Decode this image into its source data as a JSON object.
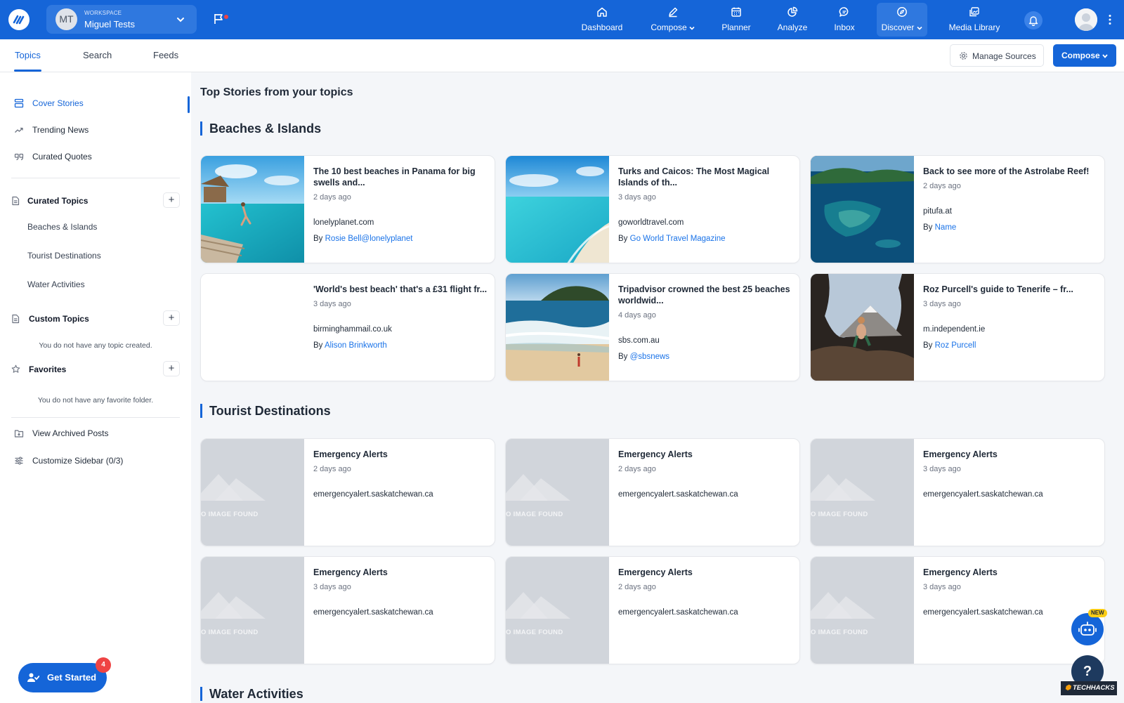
{
  "topnav": {
    "workspace_tag": "WORKSPACE",
    "workspace_initials": "MT",
    "workspace_name": "Miguel Tests",
    "items": [
      {
        "label": "Dashboard",
        "icon": "home-icon"
      },
      {
        "label": "Compose",
        "icon": "pencil-icon",
        "dropdown": true
      },
      {
        "label": "Planner",
        "icon": "calendar-icon"
      },
      {
        "label": "Analyze",
        "icon": "pie-chart-icon"
      },
      {
        "label": "Inbox",
        "icon": "chat-bubble-icon"
      },
      {
        "label": "Discover",
        "icon": "compass-icon",
        "dropdown": true,
        "active": true
      },
      {
        "label": "Media Library",
        "icon": "media-library-icon"
      }
    ]
  },
  "subbar": {
    "tabs": [
      {
        "label": "Topics",
        "active": true
      },
      {
        "label": "Search"
      },
      {
        "label": "Feeds"
      }
    ],
    "manage_sources": "Manage Sources",
    "compose": "Compose"
  },
  "sidebar": {
    "primary": [
      {
        "label": "Cover Stories",
        "icon": "layers-icon",
        "active": true
      },
      {
        "label": "Trending News",
        "icon": "trending-up-icon"
      },
      {
        "label": "Curated Quotes",
        "icon": "quote-icon"
      }
    ],
    "curated_topics": {
      "label": "Curated Topics",
      "items": [
        "Beaches & Islands",
        "Tourist Destinations",
        "Water Activities"
      ]
    },
    "custom_topics": {
      "label": "Custom Topics",
      "empty": "You do not have any topic created."
    },
    "favorites": {
      "label": "Favorites",
      "empty": "You do not have any favorite folder."
    },
    "footer": [
      {
        "label": "View Archived Posts",
        "icon": "archive-icon"
      },
      {
        "label": "Customize Sidebar (0/3)",
        "icon": "sliders-icon"
      }
    ],
    "get_started": {
      "label": "Get Started",
      "badge": "4"
    }
  },
  "main": {
    "page_title": "Top Stories from your topics",
    "sections": [
      {
        "title": "Beaches & Islands",
        "cards": [
          {
            "title": "The 10 best beaches in Panama for big swells and...",
            "time": "2 days ago",
            "source": "lonelyplanet.com",
            "by": "By",
            "author": "Rosie Bell@lonelyplanet",
            "image": "pier"
          },
          {
            "title": "Turks and Caicos: The Most Magical Islands of th...",
            "time": "3 days ago",
            "source": "goworldtravel.com",
            "by": "By",
            "author": "Go World Travel Magazine",
            "image": "beach"
          },
          {
            "title": "Back to see more of the Astrolabe Reef!",
            "time": "2 days ago",
            "source": "pitufa.at",
            "by": "By",
            "author": "Name",
            "image": "reef"
          },
          {
            "title": "'World's best beach' that's a £31 flight fr...",
            "time": "3 days ago",
            "source": "birminghammail.co.uk",
            "by": "By",
            "author": "Alison Brinkworth",
            "image": "none"
          },
          {
            "title": "Tripadvisor crowned the best 25 beaches worldwid...",
            "time": "4 days ago",
            "source": "sbs.com.au",
            "by": "By",
            "author": "@sbsnews",
            "image": "waves"
          },
          {
            "title": "Roz Purcell's guide to Tenerife – fr...",
            "time": "3 days ago",
            "source": "m.independent.ie",
            "by": "By",
            "author": "Roz Purcell",
            "image": "cave"
          }
        ]
      },
      {
        "title": "Tourist Destinations",
        "no_image_label": "O IMAGE FOUND",
        "cards": [
          {
            "title": "Emergency Alerts",
            "time": "2 days ago",
            "source": "emergencyalert.saskatchewan.ca"
          },
          {
            "title": "Emergency Alerts",
            "time": "2 days ago",
            "source": "emergencyalert.saskatchewan.ca"
          },
          {
            "title": "Emergency Alerts",
            "time": "3 days ago",
            "source": "emergencyalert.saskatchewan.ca"
          },
          {
            "title": "Emergency Alerts",
            "time": "3 days ago",
            "source": "emergencyalert.saskatchewan.ca"
          },
          {
            "title": "Emergency Alerts",
            "time": "2 days ago",
            "source": "emergencyalert.saskatchewan.ca"
          },
          {
            "title": "Emergency Alerts",
            "time": "3 days ago",
            "source": "emergencyalert.saskatchewan.ca"
          }
        ]
      },
      {
        "title": "Water Activities"
      }
    ]
  },
  "floating": {
    "new_badge": "NEW",
    "help": "?",
    "watermark": "TECHHACKS"
  },
  "colors": {
    "brand": "#1565d8",
    "link": "#1a73e8",
    "badge": "#ef4444"
  }
}
